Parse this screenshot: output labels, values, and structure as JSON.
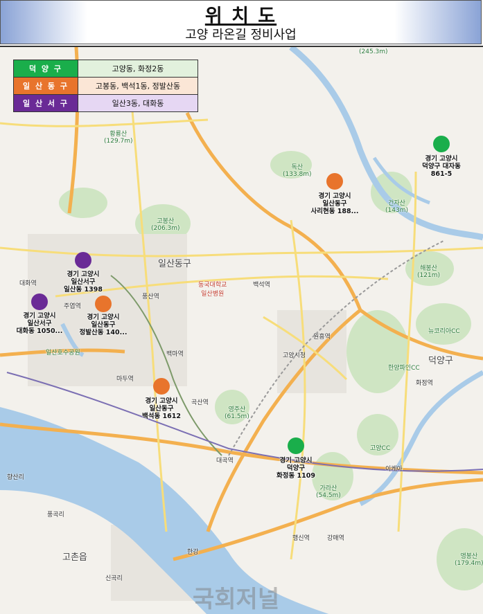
{
  "header": {
    "title": "위  치  도",
    "subtitle": "고양 라온길 정비사업"
  },
  "legend": [
    {
      "district": "덕 양 구",
      "areas": "고양동, 화정2동",
      "color": "#1aae4b",
      "bg": "#e2f1dd"
    },
    {
      "district": "일 산 동 구",
      "areas": "고봉동, 백석1동, 정발산동",
      "color": "#e8742c",
      "bg": "#fbe6d6"
    },
    {
      "district": "일 산 서 구",
      "areas": "일산3동, 대화동",
      "color": "#6a2a96",
      "bg": "#e6d7f3"
    }
  ],
  "markers": [
    {
      "name": "deokyang-daejadong",
      "color": "#1aae4b",
      "line1": "경기 고양시",
      "line2": "덕양구 대자동",
      "line3": "861-5"
    },
    {
      "name": "ilsandong-sarihyeon",
      "color": "#e8742c",
      "line1": "경기 고양시",
      "line2": "일산동구",
      "line3": "사리현동 188..."
    },
    {
      "name": "ilsanseo-ilsan",
      "color": "#6a2a96",
      "line1": "경기 고양시",
      "line2": "일산서구",
      "line3": "일산동 1398"
    },
    {
      "name": "ilsanseo-daehwa",
      "color": "#6a2a96",
      "line1": "경기 고양시",
      "line2": "일산서구",
      "line3": "대화동 1050..."
    },
    {
      "name": "ilsandong-jeongbalsan",
      "color": "#e8742c",
      "line1": "경기 고양시",
      "line2": "일산동구",
      "line3": "정발산동 140..."
    },
    {
      "name": "ilsandong-baekseok",
      "color": "#e8742c",
      "line1": "경기 고양시",
      "line2": "일산동구",
      "line3": "백석동 1612"
    },
    {
      "name": "deokyang-hwajeong",
      "color": "#1aae4b",
      "line1": "경기 고양시",
      "line2": "덕양구",
      "line3": "화정동 1109"
    }
  ],
  "places": [
    {
      "id": "ilsandonggu",
      "text": "일산동구"
    },
    {
      "id": "deokyanggu",
      "text": "덕양구"
    },
    {
      "id": "goseup",
      "text": "고촌읍"
    },
    {
      "id": "hwangryongsan",
      "text": "황룡산\n(129.7m)"
    },
    {
      "id": "gobongsan",
      "text": "고봉산\n(206.3m)"
    },
    {
      "id": "doksan",
      "text": "독산\n(133.8m)"
    },
    {
      "id": "geonjasan",
      "text": "건자산\n(143m)"
    },
    {
      "id": "haebalsan",
      "text": "해봉산\n(121m)"
    },
    {
      "id": "yeongjusan",
      "text": "영주산\n(61.5m)"
    },
    {
      "id": "garasan",
      "text": "가라산\n(54.5m)"
    },
    {
      "id": "aeyangsan",
      "text": "앵봉산\n(179.4m)"
    },
    {
      "id": "top",
      "text": "(245.3m)"
    },
    {
      "id": "pungsan",
      "text": "풍산역"
    },
    {
      "id": "baekma",
      "text": "백마역"
    },
    {
      "id": "goksan",
      "text": "곡산역"
    },
    {
      "id": "daegok",
      "text": "대곡역"
    },
    {
      "id": "wondang",
      "text": "원흥역"
    },
    {
      "id": "hwajeong",
      "text": "화정역"
    },
    {
      "id": "daehwa",
      "text": "대화역"
    },
    {
      "id": "juyeop",
      "text": "주엽역"
    },
    {
      "id": "madu",
      "text": "마두역"
    },
    {
      "id": "baekseok",
      "text": "백석역"
    },
    {
      "id": "haengsin",
      "text": "행신역"
    },
    {
      "id": "gangmae",
      "text": "강매역"
    },
    {
      "id": "ilsanlake",
      "text": "일산호수공원"
    },
    {
      "id": "goyangcityhall",
      "text": "고양시청"
    },
    {
      "id": "dongguk",
      "text": "동국대학교\n일산병원"
    },
    {
      "id": "hanyang",
      "text": "한양파인CC"
    },
    {
      "id": "newkorea",
      "text": "뉴코리아CC"
    },
    {
      "id": "goyangcc",
      "text": "고양CC"
    },
    {
      "id": "ikea",
      "text": "이케아"
    },
    {
      "id": "hangang",
      "text": "한강"
    },
    {
      "id": "gochon_singok",
      "text": "신곡리"
    },
    {
      "id": "pungok",
      "text": "풍곡리"
    },
    {
      "id": "hyangsan",
      "text": "향산리"
    }
  ],
  "watermark": "국회저널"
}
